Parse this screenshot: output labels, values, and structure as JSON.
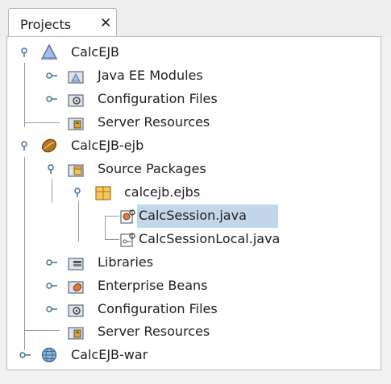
{
  "tab": {
    "label": "Projects",
    "close": "✕"
  },
  "tree": {
    "calc_ejb": {
      "label": "CalcEJB",
      "children": {
        "java_ee_modules": "Java EE Modules",
        "configuration_files": "Configuration Files",
        "server_resources": "Server Resources"
      }
    },
    "calc_ejb_ejb": {
      "label": "CalcEJB-ejb",
      "source_packages": {
        "label": "Source Packages",
        "package": {
          "label": "calcejb.ejbs",
          "files": [
            "CalcSession.java",
            "CalcSessionLocal.java"
          ]
        }
      },
      "libraries": "Libraries",
      "enterprise_beans": "Enterprise Beans",
      "configuration_files": "Configuration Files",
      "server_resources": "Server Resources"
    },
    "calc_ejb_war": {
      "label": "CalcEJB-war"
    }
  },
  "selected_item": "CalcSession.java",
  "colors": {
    "selection": "#c3d7ea",
    "panel_background": "#ffffff",
    "toggle": "#4a6f95"
  }
}
